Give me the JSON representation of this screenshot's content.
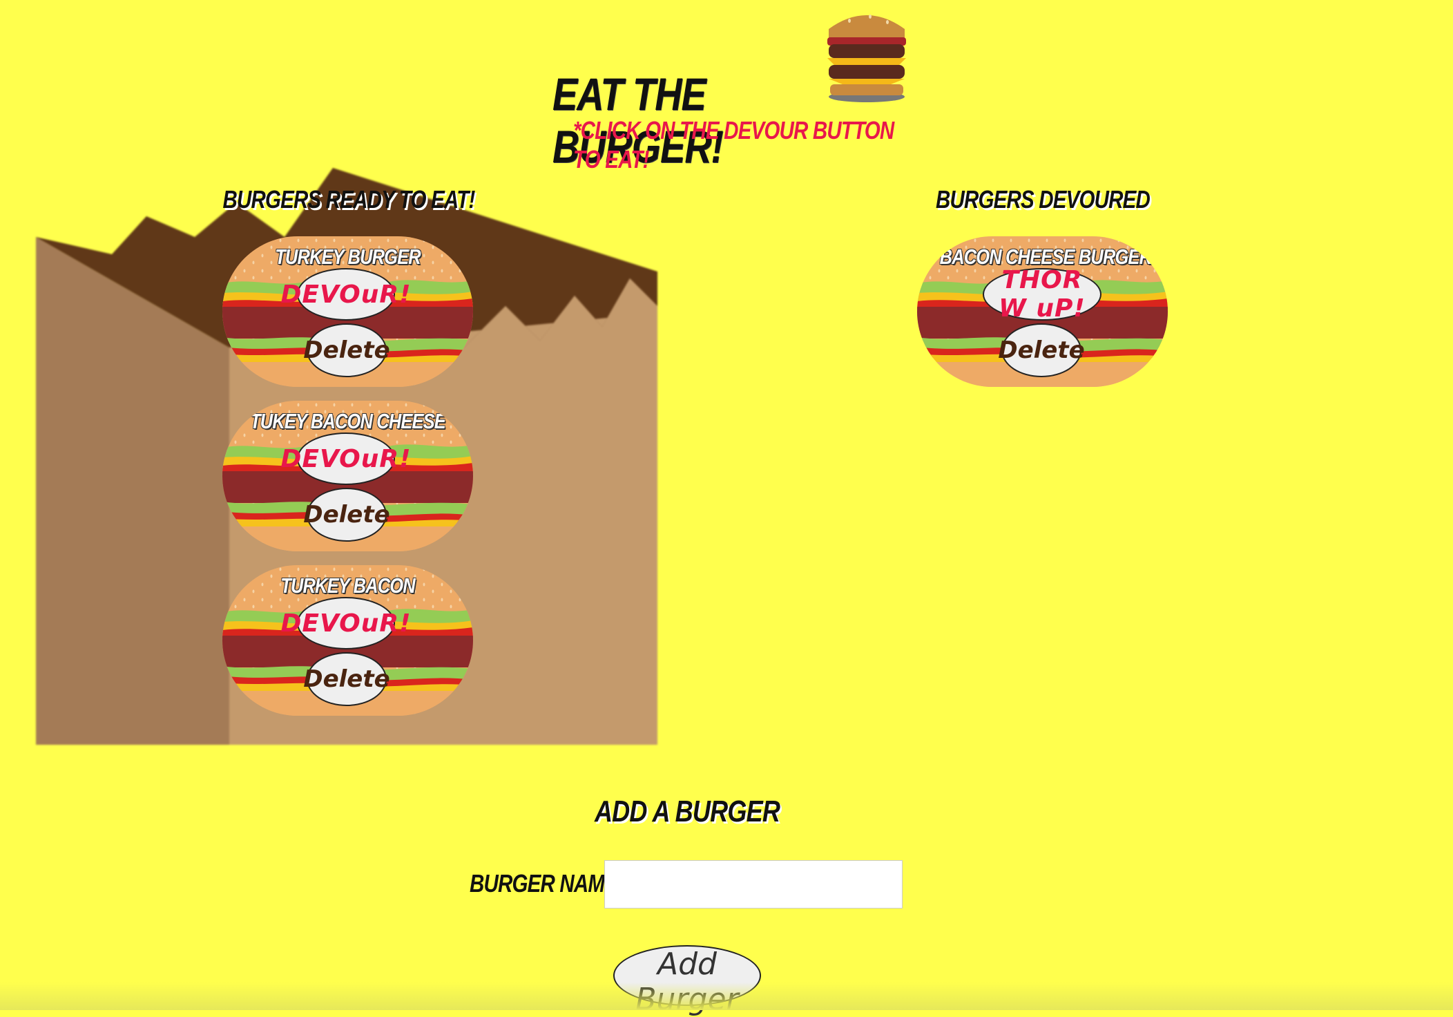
{
  "header": {
    "title": "Eat the Burger!",
    "instructions": "*Click on the devour button to eat!",
    "logo_icon": "stacked-burger-icon"
  },
  "ready": {
    "heading": "Burgers Ready to Eat!",
    "burgers": [
      {
        "name": "Turkey Burger",
        "action_label": "DEVOuR!",
        "delete_label": "Delete"
      },
      {
        "name": "Tukey Bacon Cheese",
        "action_label": "DEVOuR!",
        "delete_label": "Delete"
      },
      {
        "name": "Turkey Bacon",
        "action_label": "DEVOuR!",
        "delete_label": "Delete"
      }
    ]
  },
  "devoured": {
    "heading": "Burgers Devoured",
    "burgers": [
      {
        "name": "Bacon Cheese Burger",
        "action_label": "THOR W uP!",
        "delete_label": "Delete"
      }
    ]
  },
  "form": {
    "heading": "Add a Burger",
    "name_label": "Burger Name:",
    "name_value": "",
    "name_placeholder": "",
    "submit_label": "Add Burger"
  },
  "colors": {
    "background": "#ffff4d",
    "accent_red": "#e8174b",
    "delete_brown": "#4a2410",
    "bun": "#eeaa66",
    "patty": "#8c2a2a",
    "lettuce": "#94cc55",
    "bag": "#c49a6c"
  }
}
